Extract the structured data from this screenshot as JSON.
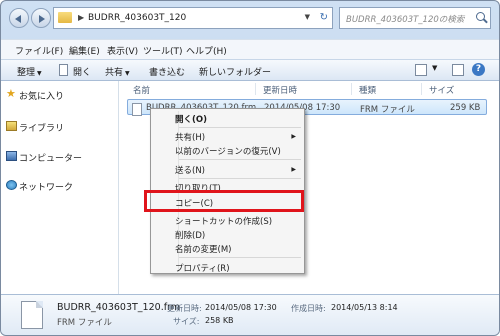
{
  "address": {
    "path": "BUDRR_403603T_120"
  },
  "search": {
    "placeholder": "BUDRR_403603T_120の検索"
  },
  "menubar": {
    "items": [
      "ファイル(F)",
      "編集(E)",
      "表示(V)",
      "ツール(T)",
      "ヘルプ(H)"
    ]
  },
  "toolbar": {
    "organize": "整理",
    "open": "開く",
    "share": "共有",
    "burn": "書き込む",
    "new_folder": "新しいフォルダー"
  },
  "navpane": {
    "favorites": "お気に入り",
    "libraries": "ライブラリ",
    "computer": "コンピューター",
    "network": "ネットワーク"
  },
  "columns": {
    "name": "名前",
    "modified": "更新日時",
    "type": "種類",
    "size": "サイズ"
  },
  "file_row": {
    "name": "BUDRR_403603T_120.frm",
    "modified": "2014/05/08 17:30",
    "type": "FRM ファイル",
    "size": "259 KB"
  },
  "context_menu": {
    "open": "開く(O)",
    "share": "共有(H)",
    "restore": "以前のバージョンの復元(V)",
    "send_to": "送る(N)",
    "cut": "切り取り(T)",
    "copy": "コピー(C)",
    "shortcut": "ショートカットの作成(S)",
    "delete": "削除(D)",
    "rename": "名前の変更(M)",
    "properties": "プロパティ(R)"
  },
  "details": {
    "name": "BUDRR_403603T_120.frm",
    "type": "FRM ファイル",
    "modified_label": "更新日時:",
    "modified_value": "2014/05/08 17:30",
    "created_label": "作成日時:",
    "created_value": "2014/05/13 8:14",
    "size_label": "サイズ:",
    "size_value": "258 KB"
  },
  "colors": {
    "highlight": "#e0141b",
    "selection": "#cde6fb"
  }
}
